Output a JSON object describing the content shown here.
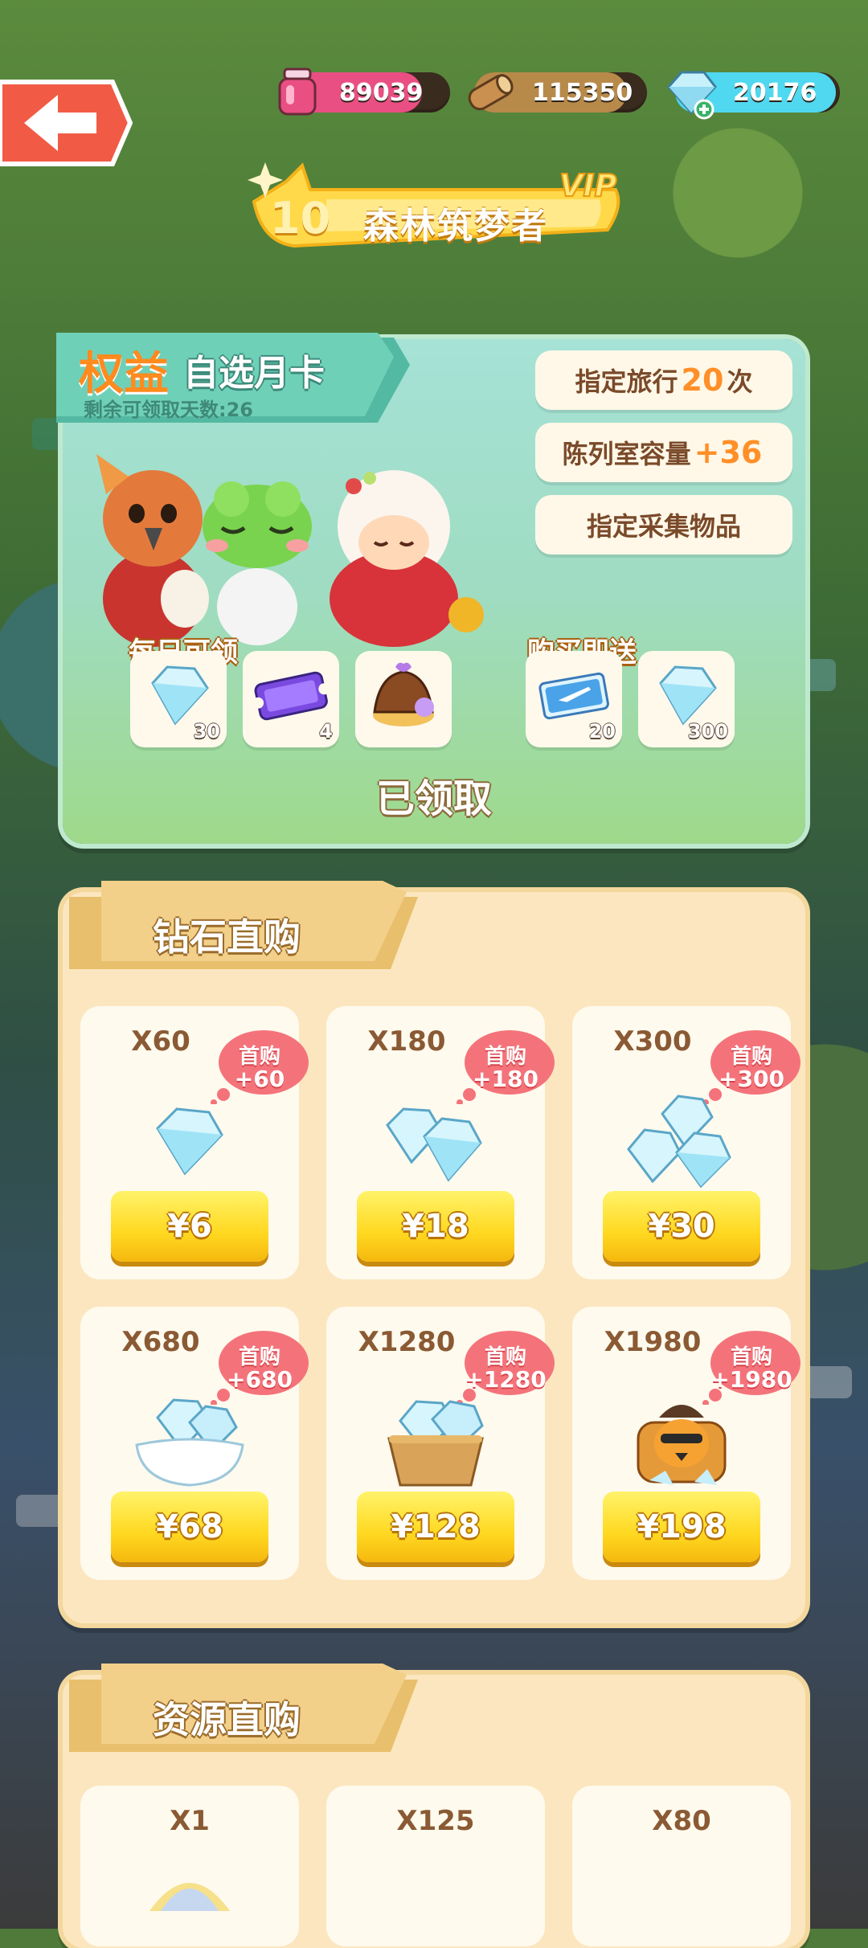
{
  "resources": [
    {
      "id": "potion",
      "value": "89039",
      "color": "#e94f83",
      "icon": "potion-jar-icon"
    },
    {
      "id": "wood",
      "value": "115350",
      "color": "#b88a4a",
      "icon": "wood-log-icon"
    },
    {
      "id": "diamond",
      "value": "20176",
      "color": "#4fd8f0",
      "icon": "diamond-plus-icon"
    }
  ],
  "vip": {
    "level": "10",
    "title": "森林筑梦者",
    "badge": "VIP"
  },
  "monthly_card": {
    "title_a": "权益",
    "title_b": "自选月卡",
    "remaining": "剩余可领取天数:26",
    "perks": [
      {
        "pre": "指定旅行",
        "num": "20",
        "post": "次"
      },
      {
        "pre": "陈列室容量",
        "num": "+36",
        "post": ""
      },
      {
        "pre": "指定采集物品",
        "num": "",
        "post": ""
      }
    ],
    "daily_label": "每日可领",
    "buy_label": "购买即送",
    "daily_items": [
      {
        "icon": "diamond-icon",
        "count": "30"
      },
      {
        "icon": "ticket-icon",
        "count": "4"
      },
      {
        "icon": "cake-bag-icon",
        "count": ""
      }
    ],
    "bonus_items": [
      {
        "icon": "travel-ticket-icon",
        "count": "20"
      },
      {
        "icon": "diamond-icon",
        "count": "300"
      }
    ],
    "status": "已领取"
  },
  "diamond_shop": {
    "title": "钻石直购",
    "items": [
      {
        "qty": "X60",
        "first": "首购",
        "bonus": "+60",
        "price": "¥6"
      },
      {
        "qty": "X180",
        "first": "首购",
        "bonus": "+180",
        "price": "¥18"
      },
      {
        "qty": "X300",
        "first": "首购",
        "bonus": "+300",
        "price": "¥30"
      },
      {
        "qty": "X680",
        "first": "首购",
        "bonus": "+680",
        "price": "¥68"
      },
      {
        "qty": "X1280",
        "first": "首购",
        "bonus": "+1280",
        "price": "¥128"
      },
      {
        "qty": "X1980",
        "first": "首购",
        "bonus": "+1980",
        "price": "¥198"
      }
    ]
  },
  "resource_shop": {
    "title": "资源直购",
    "items": [
      {
        "qty": "X1"
      },
      {
        "qty": "X125"
      },
      {
        "qty": "X80"
      }
    ]
  }
}
